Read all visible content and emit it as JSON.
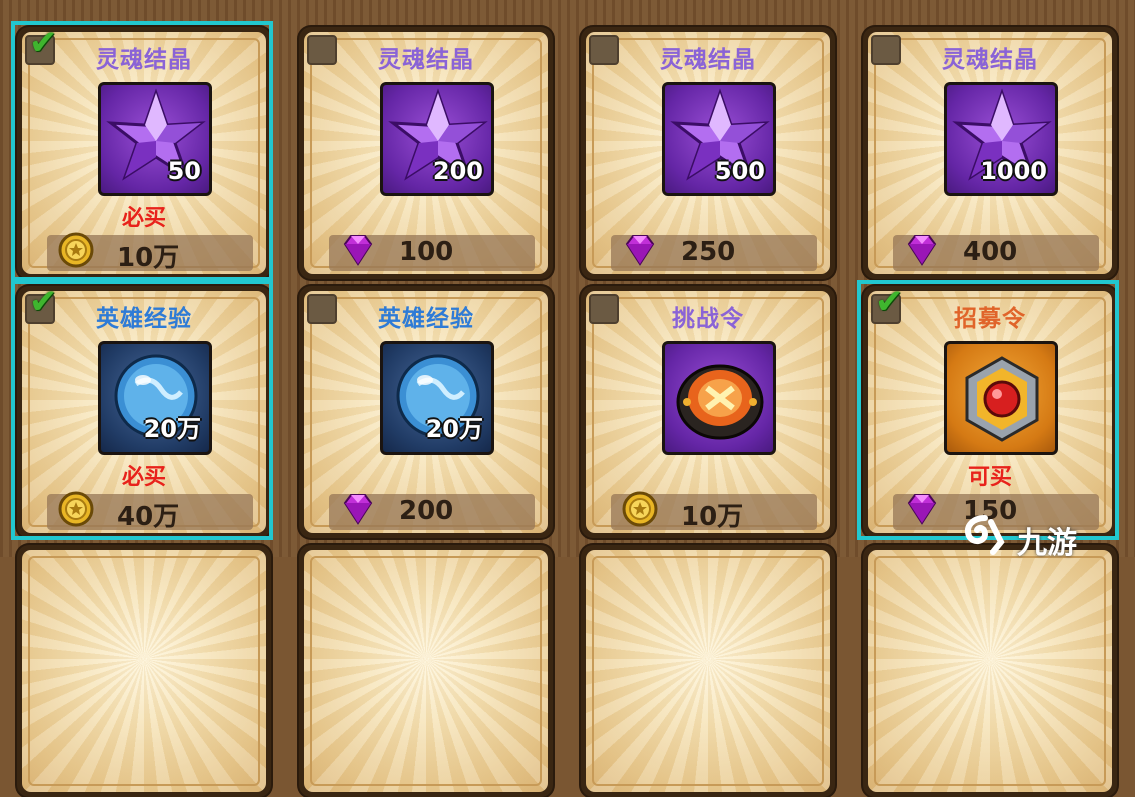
{
  "shop": {
    "items": [
      {
        "title": "灵魂结晶",
        "title_color": "#8a63d6",
        "icon": "soul-crystal-icon",
        "box": "purple",
        "qty": "50",
        "note": "必买",
        "currency": "gold-coin-icon",
        "price": "10万",
        "checked": true,
        "highlight": true
      },
      {
        "title": "灵魂结晶",
        "title_color": "#8a63d6",
        "icon": "soul-crystal-icon",
        "box": "purple",
        "qty": "200",
        "note": "",
        "currency": "diamond-icon",
        "price": "100",
        "checked": false,
        "highlight": false
      },
      {
        "title": "灵魂结晶",
        "title_color": "#8a63d6",
        "icon": "soul-crystal-icon",
        "box": "purple",
        "qty": "500",
        "note": "",
        "currency": "diamond-icon",
        "price": "250",
        "checked": false,
        "highlight": false
      },
      {
        "title": "灵魂结晶",
        "title_color": "#8a63d6",
        "icon": "soul-crystal-icon",
        "box": "purple",
        "qty": "1000",
        "note": "",
        "currency": "diamond-icon",
        "price": "400",
        "checked": false,
        "highlight": false
      },
      {
        "title": "英雄经验",
        "title_color": "#2e7bd6",
        "icon": "hero-exp-orb-icon",
        "box": "blue",
        "qty": "20万",
        "note": "必买",
        "currency": "gold-coin-icon",
        "price": "40万",
        "checked": true,
        "highlight": true
      },
      {
        "title": "英雄经验",
        "title_color": "#2e7bd6",
        "icon": "hero-exp-orb-icon",
        "box": "blue",
        "qty": "20万",
        "note": "",
        "currency": "diamond-icon",
        "price": "200",
        "checked": false,
        "highlight": false
      },
      {
        "title": "挑战令",
        "title_color": "#8a63d6",
        "icon": "challenge-token-icon",
        "box": "purple",
        "qty": "",
        "note": "",
        "currency": "gold-coin-icon",
        "price": "10万",
        "checked": false,
        "highlight": false
      },
      {
        "title": "招募令",
        "title_color": "#e0642a",
        "icon": "recruit-token-icon",
        "box": "orange",
        "qty": "",
        "note": "可买",
        "currency": "diamond-icon",
        "price": "150",
        "checked": true,
        "highlight": true
      }
    ]
  },
  "watermark": {
    "text": "九游"
  }
}
